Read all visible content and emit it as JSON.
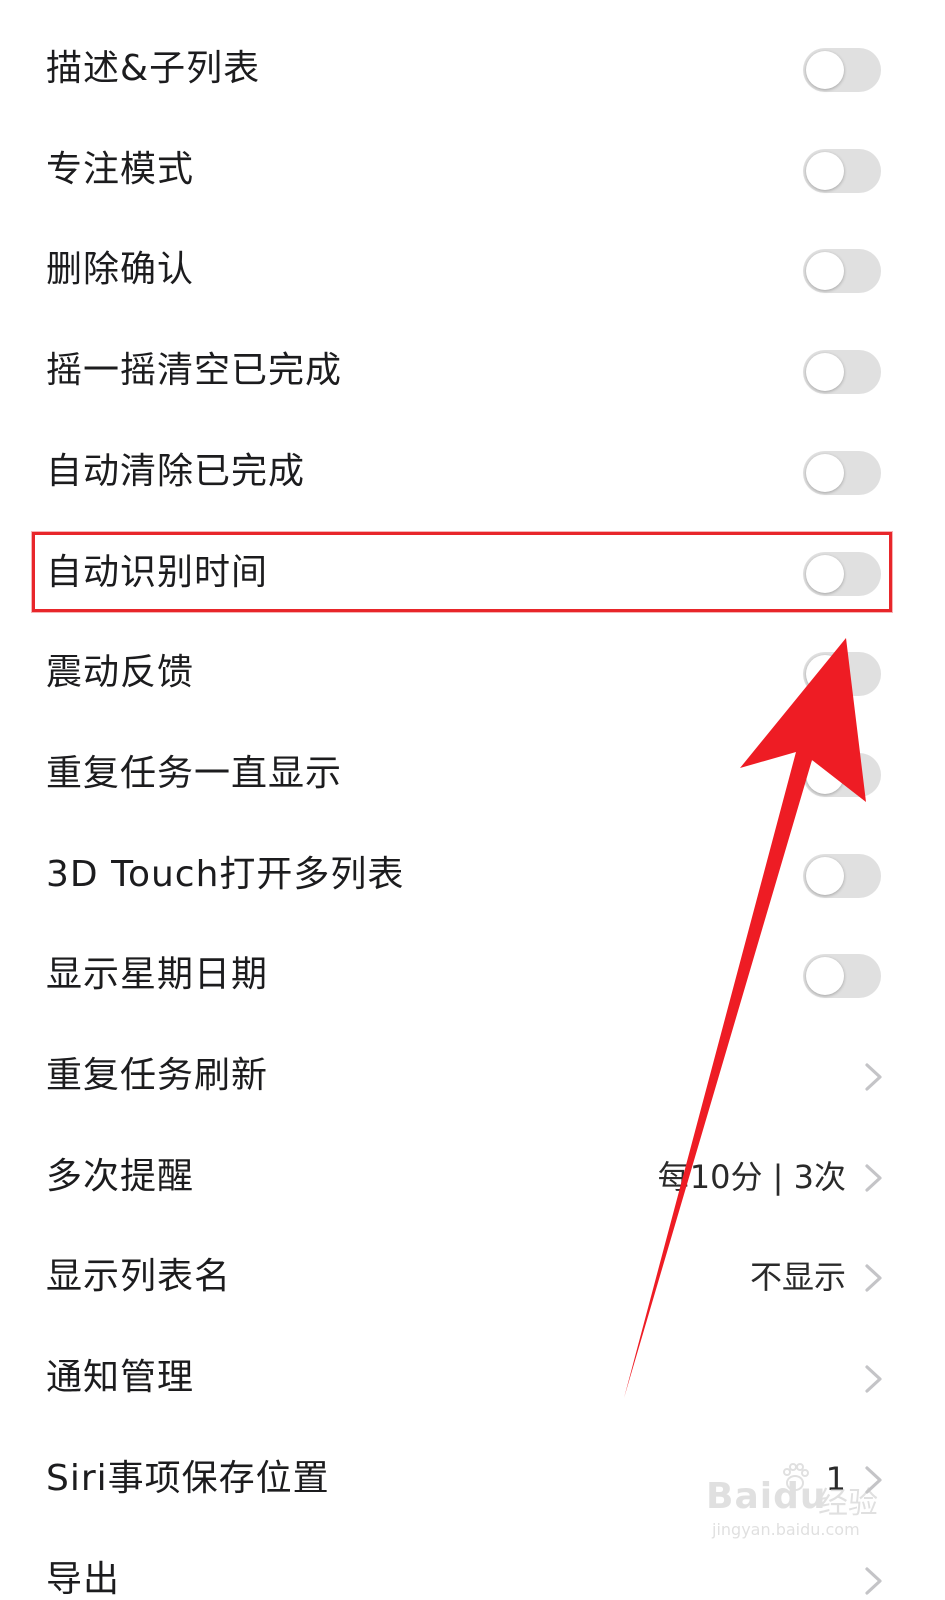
{
  "settings": {
    "items": [
      {
        "label": "描述&子列表",
        "control": "toggle",
        "on": false
      },
      {
        "label": "专注模式",
        "control": "toggle",
        "on": false
      },
      {
        "label": "删除确认",
        "control": "toggle",
        "on": false
      },
      {
        "label": "摇一摇清空已完成",
        "control": "toggle",
        "on": false
      },
      {
        "label": "自动清除已完成",
        "control": "toggle",
        "on": false
      },
      {
        "label": "自动识别时间",
        "control": "toggle",
        "on": false,
        "highlighted": true
      },
      {
        "label": "震动反馈",
        "control": "toggle",
        "on": false
      },
      {
        "label": "重复任务一直显示",
        "control": "toggle",
        "on": false
      },
      {
        "label": "3D Touch打开多列表",
        "control": "toggle",
        "on": false
      },
      {
        "label": "显示星期日期",
        "control": "toggle",
        "on": false
      },
      {
        "label": "重复任务刷新",
        "control": "chevron"
      },
      {
        "label": "多次提醒",
        "control": "chevron",
        "value": "每10分 | 3次"
      },
      {
        "label": "显示列表名",
        "control": "chevron",
        "value": "不显示"
      },
      {
        "label": "通知管理",
        "control": "chevron"
      },
      {
        "label": "Siri事项保存位置",
        "control": "chevron",
        "value": "1"
      },
      {
        "label": "导出",
        "control": "chevron"
      }
    ]
  },
  "annotation": {
    "highlight_color": "#e8262a",
    "arrow_color": "#ee1c24",
    "target_item": "自动识别时间"
  },
  "watermark": {
    "brand": "Bai",
    "brand_suffix": "du",
    "cn": "经验",
    "url": "jingyan.baidu.com"
  },
  "colors": {
    "text": "#1c1c1e",
    "toggle_off": "#e0e0e0",
    "chevron": "#c4c4c7"
  }
}
